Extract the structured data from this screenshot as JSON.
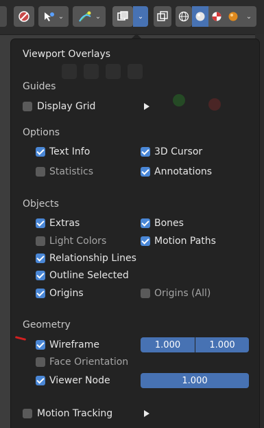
{
  "header": {
    "buttons": [
      "stop-icon",
      "select-tool-icon",
      "gizmo-icon",
      "overlays-icon",
      "xray-icon",
      "shading-wireframe-icon",
      "shading-solid-icon",
      "shading-material-icon",
      "shading-rendered-icon"
    ]
  },
  "popover": {
    "title": "Viewport Overlays",
    "guides": {
      "heading": "Guides",
      "display_grid": {
        "label": "Display Grid",
        "checked": false
      }
    },
    "options": {
      "heading": "Options",
      "text_info": {
        "label": "Text Info",
        "checked": true
      },
      "cursor_3d": {
        "label": "3D Cursor",
        "checked": true
      },
      "statistics": {
        "label": "Statistics",
        "checked": false
      },
      "annotations": {
        "label": "Annotations",
        "checked": true
      }
    },
    "objects": {
      "heading": "Objects",
      "extras": {
        "label": "Extras",
        "checked": true
      },
      "bones": {
        "label": "Bones",
        "checked": true
      },
      "light_colors": {
        "label": "Light Colors",
        "checked": false
      },
      "motion_paths": {
        "label": "Motion Paths",
        "checked": true
      },
      "relationship_lines": {
        "label": "Relationship Lines",
        "checked": true
      },
      "outline_selected": {
        "label": "Outline Selected",
        "checked": true
      },
      "origins": {
        "label": "Origins",
        "checked": true
      },
      "origins_all": {
        "label": "Origins (All)",
        "checked": false
      }
    },
    "geometry": {
      "heading": "Geometry",
      "wireframe": {
        "label": "Wireframe",
        "checked": true,
        "value_1": "1.000",
        "value_2": "1.000"
      },
      "face_orientation": {
        "label": "Face Orientation",
        "checked": false
      },
      "viewer_node": {
        "label": "Viewer Node",
        "checked": true,
        "value": "1.000"
      }
    },
    "motion_tracking": {
      "label": "Motion Tracking",
      "checked": false
    }
  },
  "colors": {
    "accent": "#4772b3",
    "checkbox_on": "#4a87d6",
    "panel_bg": "#232323",
    "annotation_mark": "#d22020"
  }
}
